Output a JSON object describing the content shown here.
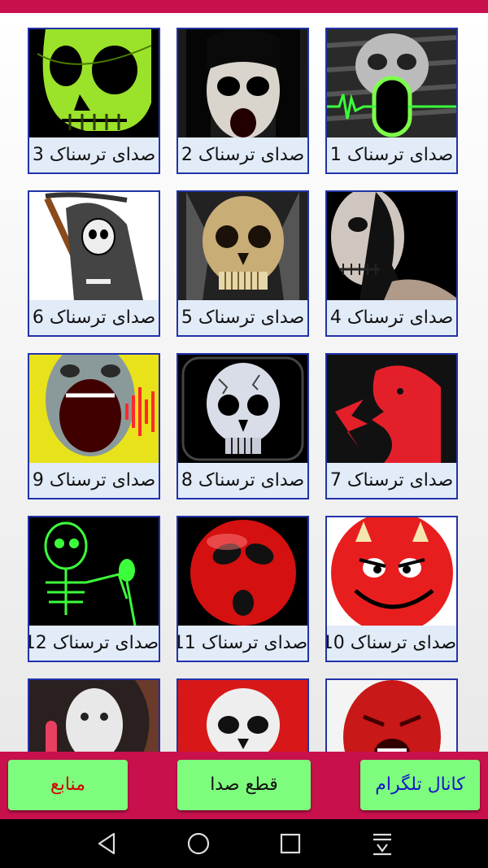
{
  "tiles": [
    {
      "label": "صدای ترسناک 3",
      "icon": "green-skull"
    },
    {
      "label": "صدای ترسناک 2",
      "icon": "ghost-girl"
    },
    {
      "label": "صدای ترسناک 1",
      "icon": "skull-microphone"
    },
    {
      "label": "صدای ترسناک 6",
      "icon": "grim-reaper"
    },
    {
      "label": "صدای ترسناک 5",
      "icon": "golden-skull"
    },
    {
      "label": "صدای ترسناک 4",
      "icon": "skull-face-paint"
    },
    {
      "label": "صدای ترسناک 9",
      "icon": "screaming-face"
    },
    {
      "label": "صدای ترسناک 8",
      "icon": "white-skull"
    },
    {
      "label": "صدای ترسناک 7",
      "icon": "red-screaming-head"
    },
    {
      "label": "صدای ترسناک 12",
      "icon": "skeleton-microphone"
    },
    {
      "label": "صدای ترسناک 11",
      "icon": "red-ghost-face"
    },
    {
      "label": "صدای ترسناک 10",
      "icon": "red-devil-smiley"
    },
    {
      "label": "",
      "icon": "hockey-mask"
    },
    {
      "label": "",
      "icon": "red-skull"
    },
    {
      "label": "",
      "icon": "red-screaming-face"
    }
  ],
  "buttons": {
    "sources": "منابع",
    "stop_sound": "قطع صدا",
    "telegram_channel": "کانال تلگرام"
  },
  "colors": {
    "header": "#c8104d",
    "button_bg": "#7dfc7d",
    "sources_text": "#d40000",
    "stop_text": "#111111",
    "telegram_text": "#1616c8"
  },
  "navbar": [
    "back-icon",
    "home-icon",
    "recents-icon",
    "notification-pull-icon"
  ]
}
